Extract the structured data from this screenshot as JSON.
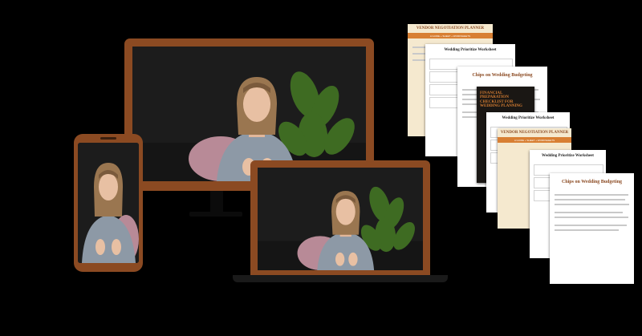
{
  "colors": {
    "background": "#000000",
    "device_frame": "#8b4a22",
    "accent_orange": "#d87f33",
    "doc_cream": "#f5e9cf",
    "doc_white": "#ffffff",
    "screen_dark": "#1f1f1f"
  },
  "documents": [
    {
      "title": "VENDOR NEGOTIATION PLANNER",
      "subtitle": "A GUIDE + SHEET + WORKSHEETS",
      "style": "orange"
    },
    {
      "title": "Wedding Prioritize Worksheet",
      "style": "white"
    },
    {
      "title": "Chips on Wedding Budgeting",
      "style": "white"
    },
    {
      "title": "FINANCIAL PREPARATION CHECKLIST FOR WEDDING PLANNING",
      "style": "dark"
    },
    {
      "title": "Wedding Prioritize Worksheet",
      "style": "white"
    },
    {
      "title": "VENDOR NEGOTIATION PLANNER",
      "subtitle": "A GUIDE + SHEET + WORKSHEETS",
      "style": "orange"
    },
    {
      "title": "Wedding Prioritize Worksheet",
      "style": "white"
    },
    {
      "title": "Chips on Wedding Budgeting",
      "style": "white"
    }
  ]
}
